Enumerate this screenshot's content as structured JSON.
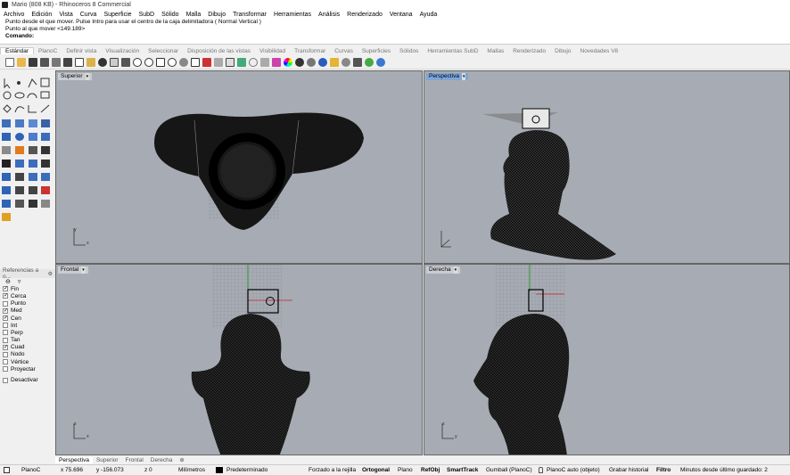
{
  "title": "Mario (808 KB) - Rhinoceros 8 Commercial",
  "menu": [
    "Archivo",
    "Edición",
    "Vista",
    "Curva",
    "Superficie",
    "SubD",
    "Sólido",
    "Malla",
    "Dibujo",
    "Transformar",
    "Herramientas",
    "Análisis",
    "Renderizado",
    "Ventana",
    "Ayuda"
  ],
  "command": {
    "line1": "Punto desde el que mover. Pulse Intro para usar el centro de la caja delimitadora ( Normal  Vertical )",
    "line2": "Punto al que mover <149.189>",
    "prompt": "Comando:"
  },
  "toolbar_tabs": [
    "Estándar",
    "PlanoC",
    "Definir vista",
    "Visualización",
    "Seleccionar",
    "Disposición de las vistas",
    "Visibilidad",
    "Transformar",
    "Curvas",
    "Superficies",
    "Sólidos",
    "Herramientas SubD",
    "Mallas",
    "Renderizado",
    "Dibujo",
    "Novedades V8"
  ],
  "viewports": {
    "top": "Superior",
    "perspective": "Perspectiva",
    "front": "Frontal",
    "right": "Derecha"
  },
  "axis": {
    "x": "x",
    "y": "y",
    "z": "z"
  },
  "osnap": {
    "title": "Referencias a o...",
    "items": [
      {
        "label": "Fin",
        "checked": true
      },
      {
        "label": "Cerca",
        "checked": true
      },
      {
        "label": "Punto",
        "checked": false
      },
      {
        "label": "Med",
        "checked": true
      },
      {
        "label": "Cen",
        "checked": true
      },
      {
        "label": "Int",
        "checked": false
      },
      {
        "label": "Perp",
        "checked": false
      },
      {
        "label": "Tan",
        "checked": false
      },
      {
        "label": "Cuad",
        "checked": true
      },
      {
        "label": "Nodo",
        "checked": false
      },
      {
        "label": "Vértice",
        "checked": false
      },
      {
        "label": "Proyectar",
        "checked": false
      }
    ],
    "disable": "Desactivar"
  },
  "viewport_tabs": [
    "Perspectiva",
    "Superior",
    "Frontal",
    "Derecha"
  ],
  "status": {
    "cplane": "PlanoC",
    "x": "x 75.696",
    "y": "y -156.073",
    "z": "z 0",
    "units": "Milímetros",
    "layer": "Predeterminado",
    "grid_snap": "Forzado a la rejilla",
    "ortho": "Ortogonal",
    "planar": "Plano",
    "osnap": "RefObj",
    "smarttrack": "SmartTrack",
    "gumball": "Gumball (PlanoC)",
    "autocplane": "PlanoC auto (objeto)",
    "history": "Grabar historial",
    "filter": "Filtro",
    "autosave": "Minutos desde último guardado: 2"
  },
  "colors": {
    "viewport_bg": "#a7acb4",
    "active_label": "#7da6d9",
    "axis_red": "#c8202a",
    "axis_green": "#2a9c2a"
  }
}
